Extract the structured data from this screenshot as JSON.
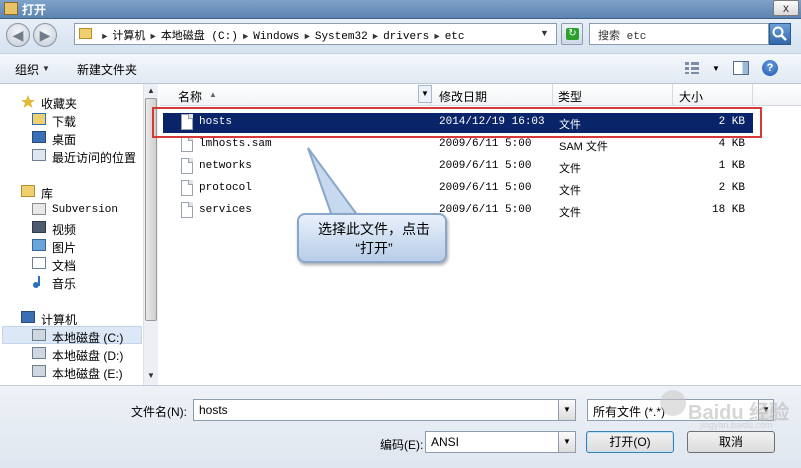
{
  "window": {
    "title": "打开",
    "close": "x"
  },
  "address": {
    "crumbs": [
      "计算机",
      "本地磁盘 (C:)",
      "Windows",
      "System32",
      "drivers",
      "etc"
    ],
    "separator": "►",
    "dropdown": "▼"
  },
  "search": {
    "text": "搜索 etc"
  },
  "toolbar": {
    "organize": "组织",
    "organize_arrow": "▼",
    "new_folder": "新建文件夹",
    "view_arrow": "▼",
    "help": "?"
  },
  "nav": {
    "favorites": {
      "label": "收藏夹",
      "items": [
        "下载",
        "桌面",
        "最近访问的位置"
      ]
    },
    "libraries": {
      "label": "库",
      "items": [
        "Subversion",
        "视频",
        "图片",
        "文档",
        "音乐"
      ]
    },
    "computer": {
      "label": "计算机",
      "items": [
        "本地磁盘 (C:)",
        "本地磁盘 (D:)",
        "本地磁盘 (E:)"
      ]
    },
    "scroll_up": "▲",
    "scroll_down": "▼"
  },
  "columns": {
    "name": "名称",
    "name_sort": "▲",
    "name_drop": "▼",
    "date": "修改日期",
    "type": "类型",
    "size": "大小"
  },
  "files": [
    {
      "name": "hosts",
      "date": "2014/12/19 16:03",
      "type": "文件",
      "size": "2 KB"
    },
    {
      "name": "lmhosts.sam",
      "date": "2009/6/11 5:00",
      "type": "SAM 文件",
      "size": "4 KB"
    },
    {
      "name": "networks",
      "date": "2009/6/11 5:00",
      "type": "文件",
      "size": "1 KB"
    },
    {
      "name": "protocol",
      "date": "2009/6/11 5:00",
      "type": "文件",
      "size": "2 KB"
    },
    {
      "name": "services",
      "date": "2009/6/11 5:00",
      "type": "文件",
      "size": "18 KB"
    }
  ],
  "callout": {
    "line1": "选择此文件，点击",
    "line2": "“打开”"
  },
  "bottom": {
    "filename_label": "文件名(N):",
    "filename_value": "hosts",
    "filetype_value": "所有文件 (*.*)",
    "encoding_label": "编码(E):",
    "encoding_value": "ANSI",
    "open": "打开(O)",
    "cancel": "取消",
    "drop": "▼"
  },
  "watermark": {
    "text": "Baidu 经验",
    "sub": "jingyan.baidu.com"
  },
  "colors": {
    "selection": "#0a246a",
    "highlight": "#d73838"
  }
}
